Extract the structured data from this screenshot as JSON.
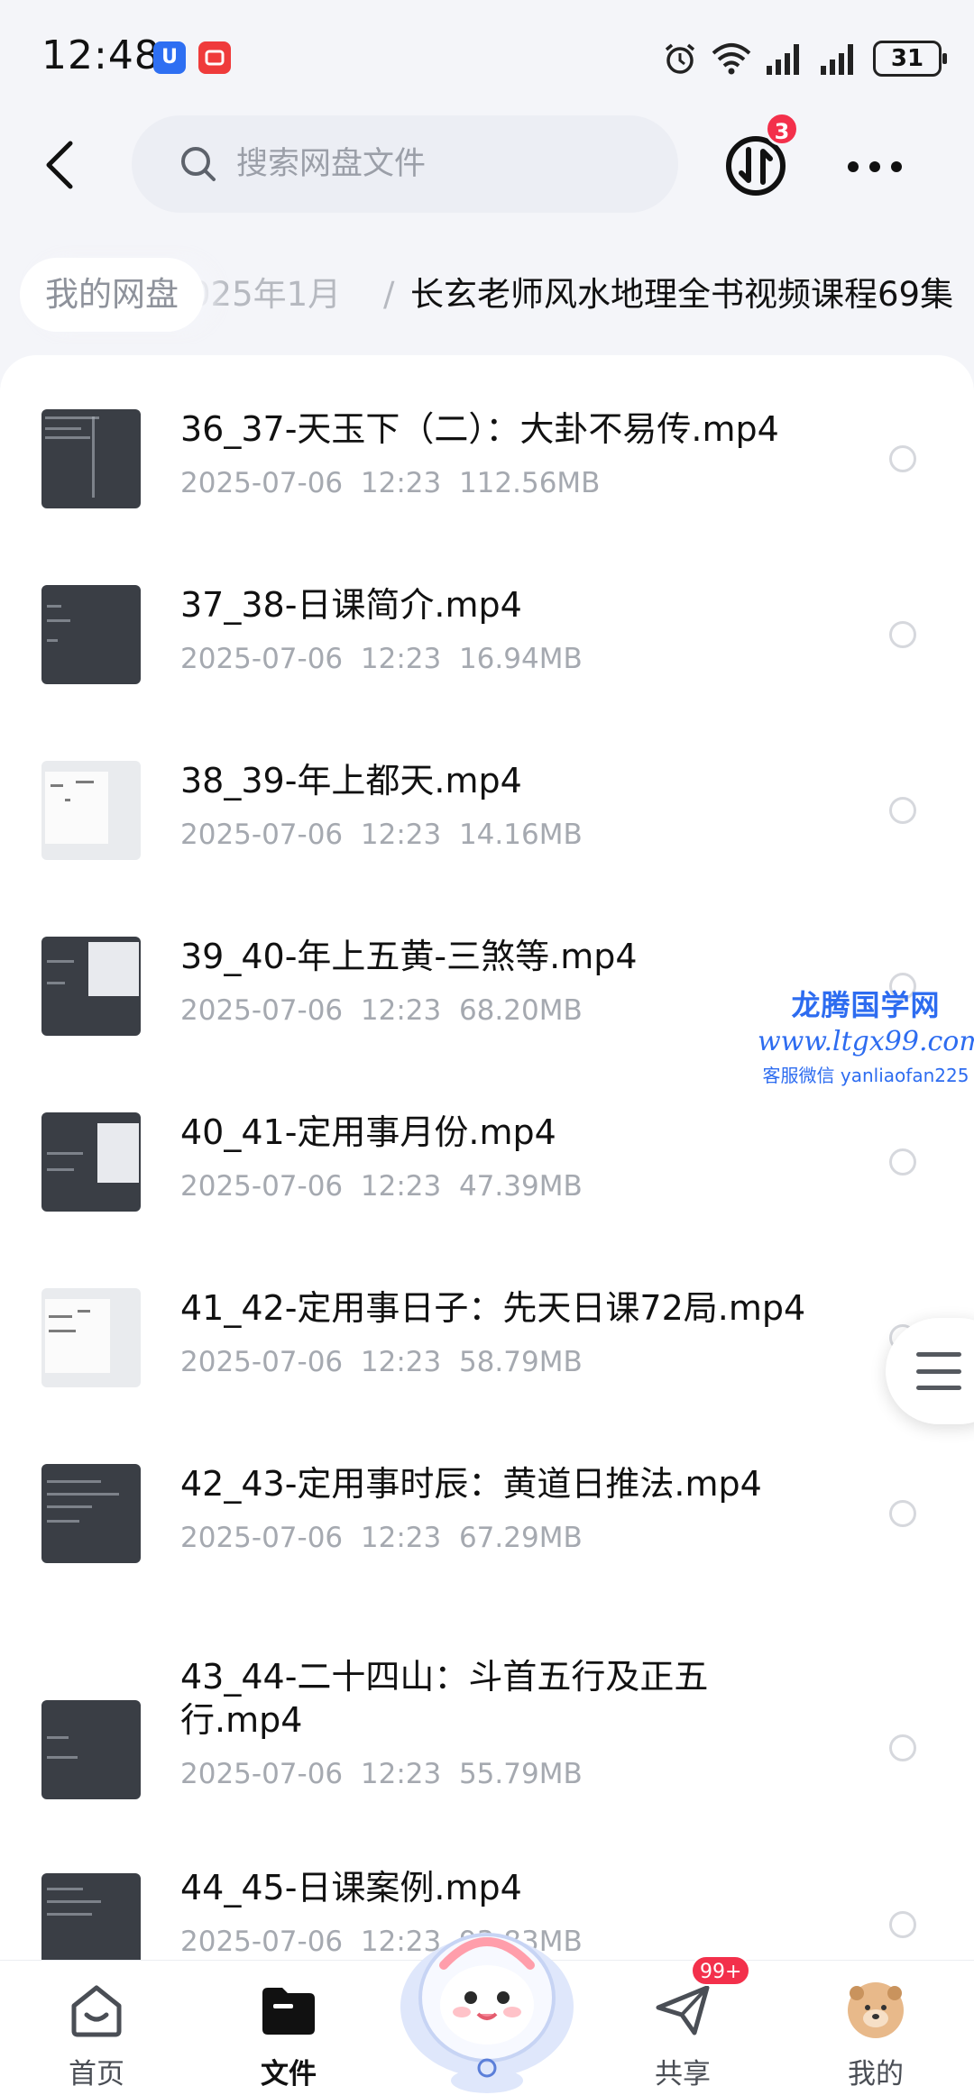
{
  "status_bar": {
    "time": "12:48",
    "app_badge_1": "U",
    "app_badge_2": "",
    "battery": "31"
  },
  "top_nav": {
    "search_placeholder": "搜索网盘文件",
    "transfer_badge": "3"
  },
  "breadcrumb": {
    "root": "我的网盘",
    "parent": "025年1月",
    "separator": "/",
    "current": "长玄老师风水地理全书视频课程69集"
  },
  "files": [
    {
      "name": "36_37-天玉下（二）：大卦不易传.mp4",
      "date": "2025-07-06",
      "time": "12:23",
      "size": "112.56MB"
    },
    {
      "name": "37_38-日课简介.mp4",
      "date": "2025-07-06",
      "time": "12:23",
      "size": "16.94MB"
    },
    {
      "name": "38_39-年上都天.mp4",
      "date": "2025-07-06",
      "time": "12:23",
      "size": "14.16MB"
    },
    {
      "name": "39_40-年上五黄-三煞等.mp4",
      "date": "2025-07-06",
      "time": "12:23",
      "size": "68.20MB"
    },
    {
      "name": "40_41-定用事月份.mp4",
      "date": "2025-07-06",
      "time": "12:23",
      "size": "47.39MB"
    },
    {
      "name": "41_42-定用事日子：先天日课72局.mp4",
      "date": "2025-07-06",
      "time": "12:23",
      "size": "58.79MB"
    },
    {
      "name": "42_43-定用事时辰：黄道日推法.mp4",
      "date": "2025-07-06",
      "time": "12:23",
      "size": "67.29MB"
    },
    {
      "name": "43_44-二十四山：斗首五行及正五行.mp4",
      "date": "2025-07-06",
      "time": "12:23",
      "size": "55.79MB"
    },
    {
      "name": "44_45-日课案例.mp4",
      "date": "2025-07-06",
      "time": "12:23",
      "size": "93.83MB"
    }
  ],
  "watermark": {
    "title": "龙腾国学网",
    "url": "www.ltgx99.com",
    "contact": "客服微信 yanliaofan225"
  },
  "bottom_nav": {
    "home": "首页",
    "files": "文件",
    "share": "共享",
    "share_badge": "99+",
    "mine": "我的"
  },
  "colors": {
    "accent_red": "#f3304b",
    "watermark_blue": "#2d6cf0",
    "background": "#f4f5f9"
  }
}
